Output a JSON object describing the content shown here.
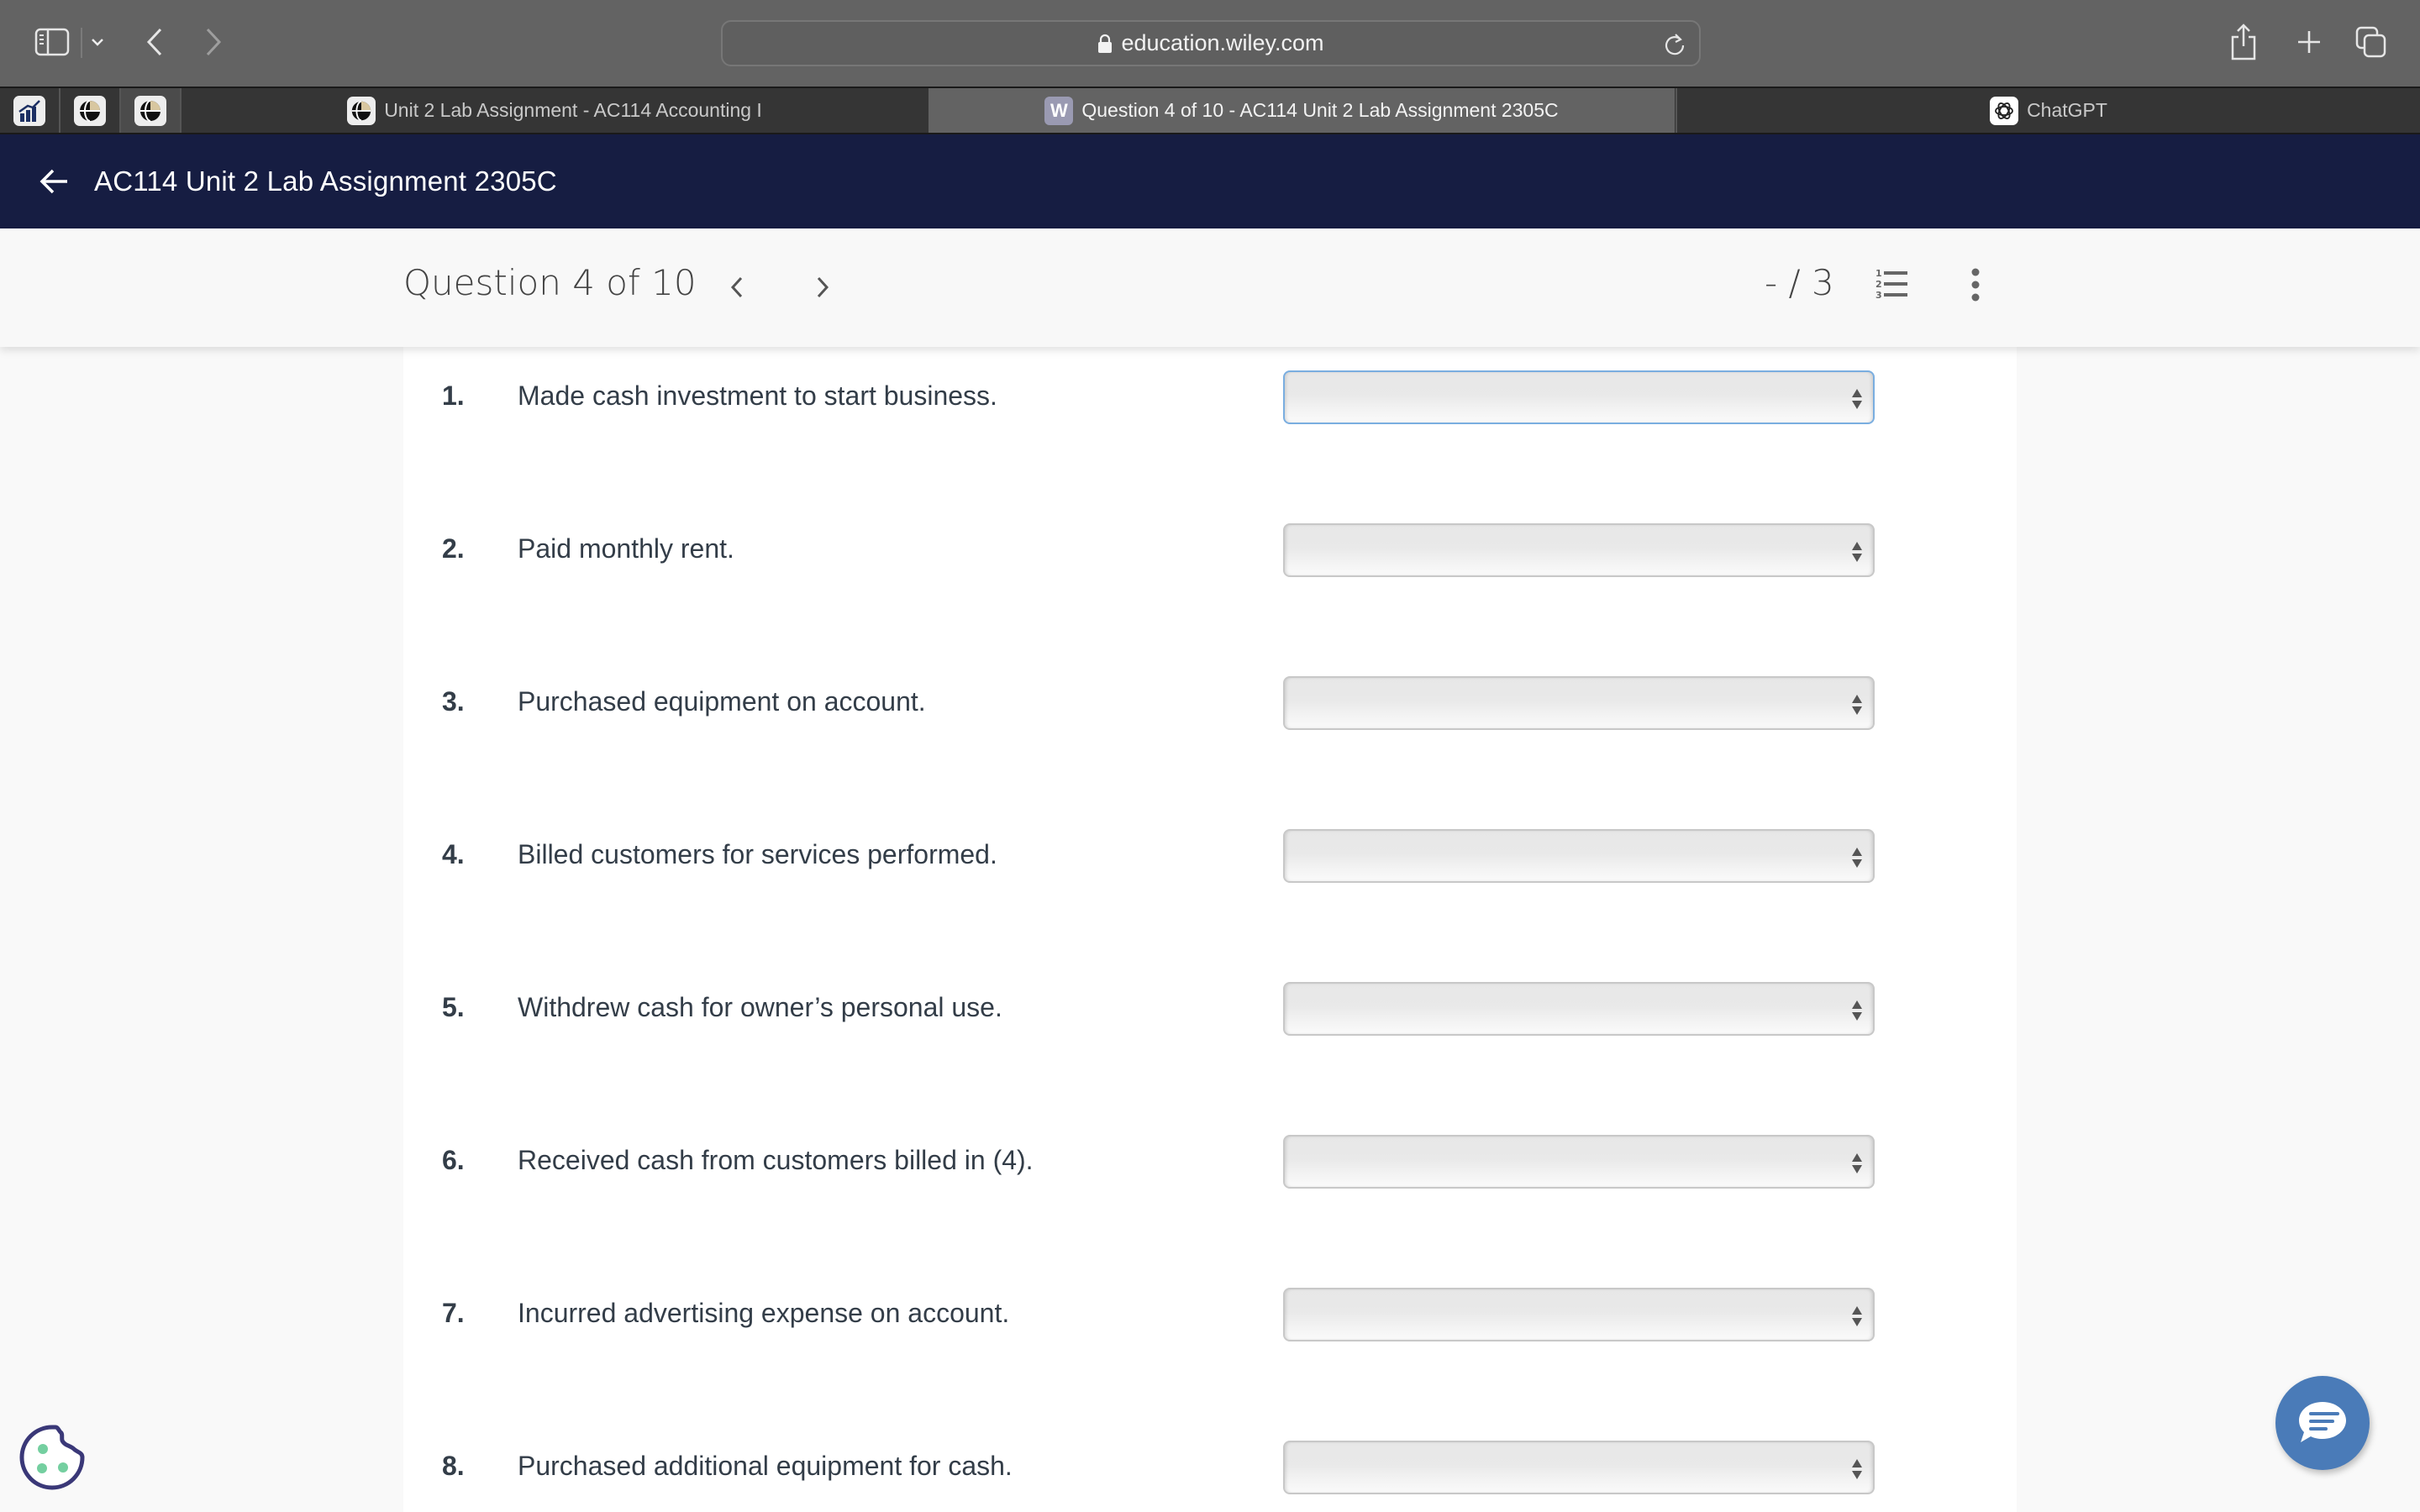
{
  "browser": {
    "url": "education.wiley.com",
    "icons": {
      "sidebar": "sidebar-icon",
      "back": "chevron-left-icon",
      "forward": "chevron-right-icon",
      "lock": "lock-icon",
      "reload": "reload-icon",
      "share": "share-icon",
      "new_tab": "plus-icon",
      "tab_overview": "tabs-icon"
    },
    "pinned_tabs": [
      {
        "icon": "chart-favicon"
      },
      {
        "icon": "globe-favicon"
      },
      {
        "icon": "globe-favicon",
        "active": true
      }
    ],
    "tabs": [
      {
        "title": "Unit 2 Lab Assignment - AC114 Accounting I",
        "icon": "globe-favicon"
      },
      {
        "title": "Question 4 of 10 - AC114 Unit 2 Lab Assignment 2305C",
        "icon": "W",
        "current": true
      },
      {
        "title": "ChatGPT",
        "icon": "openai-favicon"
      }
    ]
  },
  "appbar": {
    "title": "AC114 Unit 2 Lab Assignment 2305C",
    "bg_color": "#161d42"
  },
  "question_header": {
    "title": "Question 4 of 10",
    "score": "- / 3"
  },
  "items": [
    {
      "num": "1.",
      "text": "Made cash investment to start business.",
      "selected": "",
      "focused": true
    },
    {
      "num": "2.",
      "text": "Paid monthly rent.",
      "selected": ""
    },
    {
      "num": "3.",
      "text": "Purchased equipment on account.",
      "selected": ""
    },
    {
      "num": "4.",
      "text": "Billed customers for services performed.",
      "selected": ""
    },
    {
      "num": "5.",
      "text": "Withdrew cash for owner’s personal use.",
      "selected": ""
    },
    {
      "num": "6.",
      "text": "Received cash from customers billed in (4).",
      "selected": ""
    },
    {
      "num": "7.",
      "text": "Incurred advertising expense on account.",
      "selected": ""
    },
    {
      "num": "8.",
      "text": "Purchased additional equipment for cash.",
      "selected": ""
    }
  ],
  "colors": {
    "focus_border": "#7aaee0",
    "chat_button": "#4a7bb8",
    "cookie_outline": "#3a3878",
    "cookie_dots": "#74cfa0"
  }
}
